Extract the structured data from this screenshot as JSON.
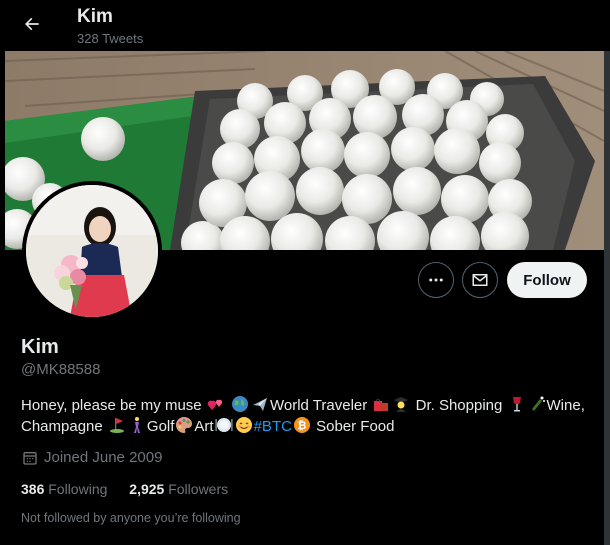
{
  "header": {
    "title": "Kim",
    "tweet_count": "328 Tweets",
    "back_icon": "arrow-left-icon"
  },
  "profile": {
    "display_name": "Kim",
    "handle": "@MK88588",
    "bio": {
      "t1": "Honey, please be my muse",
      "t2": "World Traveler",
      "t3": " Dr. Shopping",
      "t4": "Wine, Champagne",
      "t5": "Golf",
      "t6": "Art",
      "hashtag": "#BTC",
      "t7": " Sober Food"
    },
    "joined": "Joined June 2009",
    "following_count": "386",
    "following_label": "Following",
    "followers_count": "2,925",
    "followers_label": "Followers",
    "not_followed": "Not followed by anyone you’re following"
  },
  "actions": {
    "follow_label": "Follow",
    "more_icon": "more-icon",
    "message_icon": "envelope-icon"
  },
  "colors": {
    "background": "#000000",
    "text_primary": "#e7e9ea",
    "text_secondary": "#71767b",
    "accent": "#1d9bf0",
    "follow_bg": "#eff3f4"
  }
}
